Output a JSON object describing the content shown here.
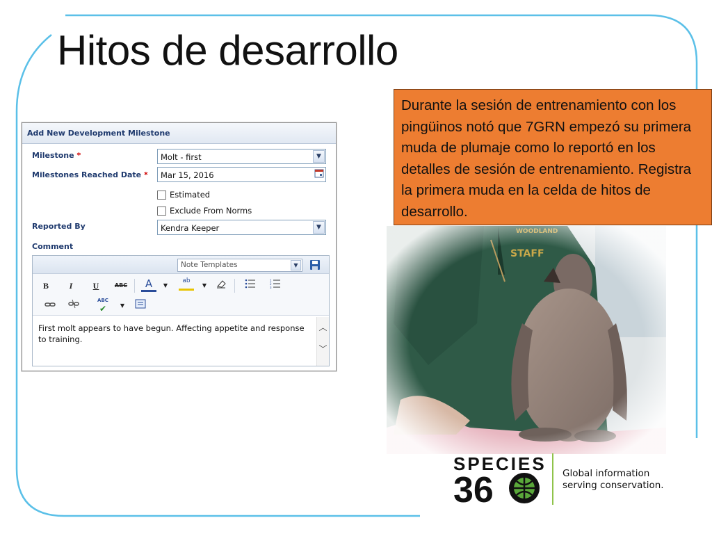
{
  "slide": {
    "title": "Hitos de desarrollo",
    "callout": "Durante la sesión de entrenamiento con los pingüinos notó que 7GRN empezó su primera muda de plumaje como lo reportó en los detalles de sesión de entrenamiento.  Registra la primera muda en la celda de hitos de desarrollo."
  },
  "form": {
    "header": "Add New Development Milestone",
    "milestone_label": "Milestone",
    "milestone_value": "Molt - first",
    "date_label": "Milestones Reached Date",
    "date_value": "Mar 15, 2016",
    "estimated_label": "Estimated",
    "exclude_label": "Exclude From Norms",
    "reported_by_label": "Reported By",
    "reported_by_value": "Kendra Keeper",
    "comment_label": "Comment",
    "required_mark": "*",
    "note_templates": "Note Templates",
    "comment_text": "First molt appears to have begun. Affecting appetite and response to training.",
    "toolbar": {
      "bold": "B",
      "italic": "I",
      "underline": "U",
      "strike": "ABC",
      "font_color": "A",
      "highlight": "ab",
      "spell": "ABC"
    }
  },
  "photo": {
    "badge_text": "WOODLAND PARK ZOO STAFF"
  },
  "logo": {
    "brand_top": "SPECIES",
    "brand_bottom": "360",
    "tagline_line1": "Global information",
    "tagline_line2": "serving conservation."
  },
  "colors": {
    "frame": "#5bc0e8",
    "callout_bg": "#ed7d31",
    "form_label": "#1f3a6e",
    "logo_accent": "#8fc34a"
  }
}
